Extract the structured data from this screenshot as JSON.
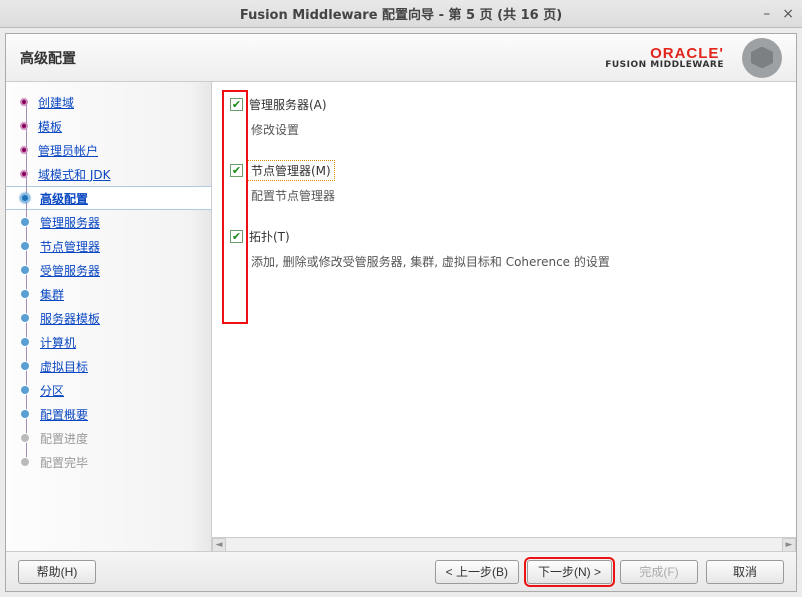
{
  "window": {
    "title": "Fusion Middleware 配置向导 - 第 5 页 (共 16 页)"
  },
  "header": {
    "title": "高级配置",
    "brand_top": "ORACLE",
    "brand_bottom": "FUSION MIDDLEWARE"
  },
  "steps": [
    {
      "label": "创建域",
      "state": "done",
      "link": true
    },
    {
      "label": "模板",
      "state": "done",
      "link": true
    },
    {
      "label": "管理员帐户",
      "state": "done",
      "link": true
    },
    {
      "label": "域模式和 JDK",
      "state": "done",
      "link": true
    },
    {
      "label": "高级配置",
      "state": "current",
      "link": true
    },
    {
      "label": "管理服务器",
      "state": "todo-blue",
      "link": true
    },
    {
      "label": "节点管理器",
      "state": "todo-blue",
      "link": true
    },
    {
      "label": "受管服务器",
      "state": "todo-blue",
      "link": true
    },
    {
      "label": "集群",
      "state": "todo-blue",
      "link": true
    },
    {
      "label": "服务器模板",
      "state": "todo-blue",
      "link": true
    },
    {
      "label": "计算机",
      "state": "todo-blue",
      "link": true
    },
    {
      "label": "虚拟目标",
      "state": "todo-blue",
      "link": true
    },
    {
      "label": "分区",
      "state": "todo-blue",
      "link": true
    },
    {
      "label": "配置概要",
      "state": "todo-blue",
      "link": true
    },
    {
      "label": "配置进度",
      "state": "todo-gray",
      "link": false
    },
    {
      "label": "配置完毕",
      "state": "todo-gray",
      "link": false
    }
  ],
  "options": [
    {
      "label": "管理服务器(A)",
      "desc": "修改设置",
      "checked": true,
      "focused": false
    },
    {
      "label": "节点管理器(M)",
      "desc": "配置节点管理器",
      "checked": true,
      "focused": true
    },
    {
      "label": "拓扑(T)",
      "desc": "添加, 删除或修改受管服务器, 集群, 虚拟目标和 Coherence 的设置",
      "checked": true,
      "focused": false
    }
  ],
  "footer": {
    "help": "帮助(H)",
    "back": "< 上一步(B)",
    "next": "下一步(N) >",
    "finish": "完成(F)",
    "cancel": "取消"
  }
}
